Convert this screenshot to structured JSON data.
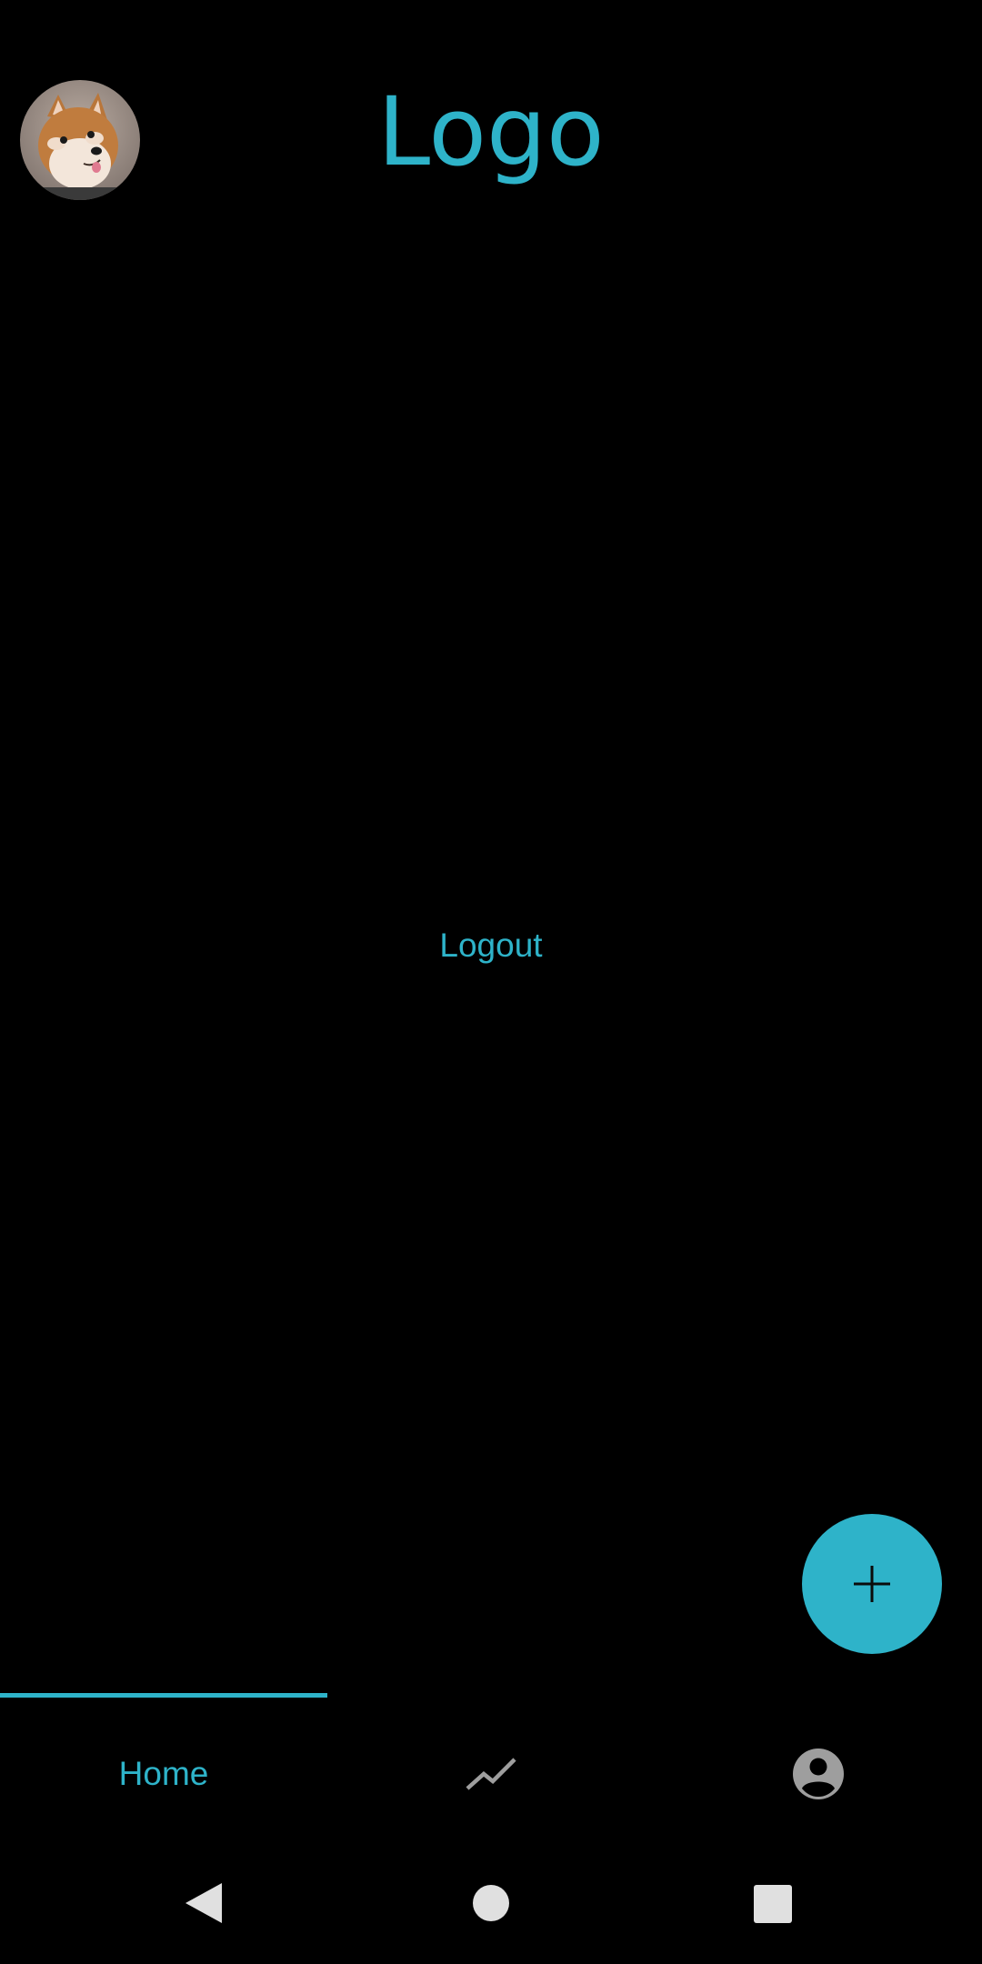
{
  "header": {
    "logo_text": "Logo",
    "avatar_icon": "shiba-inu-profile-photo"
  },
  "main": {
    "logout_label": "Logout"
  },
  "fab": {
    "icon": "plus-icon"
  },
  "bottom_nav": {
    "tabs": [
      {
        "label": "Home",
        "selected": true
      },
      {
        "icon": "trending-chart-icon",
        "selected": false
      },
      {
        "icon": "account-circle-icon",
        "selected": false
      }
    ]
  },
  "system_nav": {
    "buttons": [
      "back-icon",
      "home-icon",
      "recents-icon"
    ]
  },
  "colors": {
    "background": "#000000",
    "accent": "#2eb3c9",
    "inactive_icon": "#9e9e9e",
    "system_nav_icon": "#e0e0e0"
  }
}
